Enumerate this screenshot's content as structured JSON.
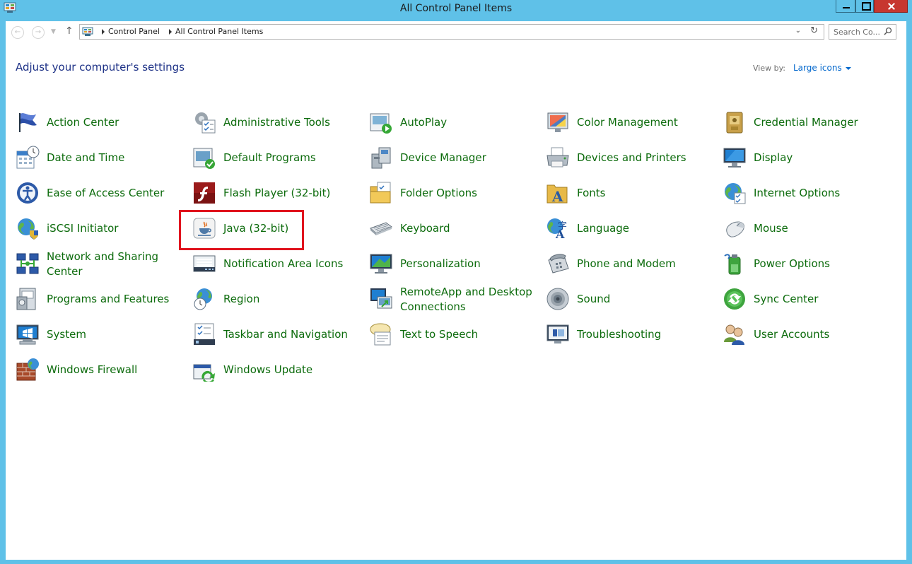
{
  "window": {
    "title": "All Control Panel Items"
  },
  "navigation": {
    "breadcrumb": [
      "Control Panel",
      "All Control Panel Items"
    ],
    "search_placeholder": "Search Co..."
  },
  "header": {
    "heading": "Adjust your computer's settings",
    "view_by_label": "View by:",
    "view_by_value": "Large icons"
  },
  "items": [
    {
      "label": "Action Center",
      "icon": "flag-icon"
    },
    {
      "label": "Administrative Tools",
      "icon": "admin-tools-icon"
    },
    {
      "label": "AutoPlay",
      "icon": "autoplay-icon"
    },
    {
      "label": "Color Management",
      "icon": "color-management-icon"
    },
    {
      "label": "Credential Manager",
      "icon": "credential-manager-icon"
    },
    {
      "label": "Date and Time",
      "icon": "date-time-icon"
    },
    {
      "label": "Default Programs",
      "icon": "default-programs-icon"
    },
    {
      "label": "Device Manager",
      "icon": "device-manager-icon"
    },
    {
      "label": "Devices and Printers",
      "icon": "printer-icon"
    },
    {
      "label": "Display",
      "icon": "display-icon"
    },
    {
      "label": "Ease of Access Center",
      "icon": "ease-of-access-icon"
    },
    {
      "label": "Flash Player (32-bit)",
      "icon": "flash-player-icon"
    },
    {
      "label": "Folder Options",
      "icon": "folder-options-icon"
    },
    {
      "label": "Fonts",
      "icon": "fonts-icon"
    },
    {
      "label": "Internet Options",
      "icon": "internet-options-icon"
    },
    {
      "label": "iSCSI Initiator",
      "icon": "iscsi-icon"
    },
    {
      "label": "Java (32-bit)",
      "icon": "java-icon"
    },
    {
      "label": "Keyboard",
      "icon": "keyboard-icon"
    },
    {
      "label": "Language",
      "icon": "language-icon"
    },
    {
      "label": "Mouse",
      "icon": "mouse-icon"
    },
    {
      "label": "Network and Sharing Center",
      "line1": "Network and Sharing",
      "line2": "Center",
      "icon": "network-icon"
    },
    {
      "label": "Notification Area Icons",
      "icon": "notification-area-icon"
    },
    {
      "label": "Personalization",
      "icon": "personalization-icon"
    },
    {
      "label": "Phone and Modem",
      "icon": "phone-modem-icon"
    },
    {
      "label": "Power Options",
      "icon": "power-options-icon"
    },
    {
      "label": "Programs and Features",
      "icon": "programs-features-icon"
    },
    {
      "label": "Region",
      "icon": "region-icon"
    },
    {
      "label": "RemoteApp and Desktop Connections",
      "line1": "RemoteApp and Desktop",
      "line2": "Connections",
      "icon": "remoteapp-icon"
    },
    {
      "label": "Sound",
      "icon": "sound-icon"
    },
    {
      "label": "Sync Center",
      "icon": "sync-center-icon"
    },
    {
      "label": "System",
      "icon": "system-icon"
    },
    {
      "label": "Taskbar and Navigation",
      "icon": "taskbar-icon"
    },
    {
      "label": "Text to Speech",
      "icon": "text-to-speech-icon"
    },
    {
      "label": "Troubleshooting",
      "icon": "troubleshooting-icon"
    },
    {
      "label": "User Accounts",
      "icon": "user-accounts-icon"
    },
    {
      "label": "Windows Firewall",
      "icon": "firewall-icon"
    },
    {
      "label": "Windows Update",
      "icon": "windows-update-icon"
    }
  ],
  "colors": {
    "titlebar": "#5fc1e8",
    "item_text": "#0c6b0c",
    "heading_text": "#1e3287",
    "link": "#0066cc",
    "highlight": "#e0141e"
  }
}
